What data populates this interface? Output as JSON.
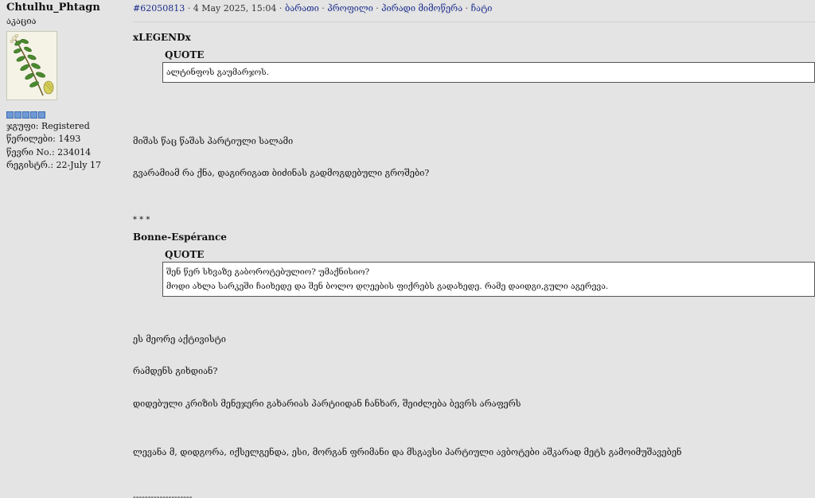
{
  "author": {
    "username": "Chtulhu_Phtagn",
    "title": "აკაცია",
    "avatar_icon": "acacia-branch-illustration",
    "rank_pips": 5,
    "group": "ჯგუფი: Registered",
    "posts": "წერილები: 1493",
    "member_no": "წევრი No.: 234014",
    "registered": "რეგისტრ.: 22-July 17"
  },
  "post_header": {
    "post_id": "#62050813",
    "date": "4 May 2025, 15:04",
    "links": [
      "ბარათი",
      "პროფილი",
      "პირადი მიმოწერა",
      "ჩატი"
    ]
  },
  "quotes": [
    {
      "author": "xLEGENDx",
      "label": "QUOTE",
      "lines": [
        "ალტინფოს გაუმარჯოს."
      ]
    },
    {
      "author": "Bonne-Espérance",
      "label": "QUOTE",
      "lines": [
        "შენ წერ სხვაზე გაბოროტებულიო? უმაქნისიო?",
        "მოდი ახლა სარკეში ჩაიხედე და შენ ბოლო დღეების ფიქრებს გადახედე. რამე დაიდგი,გული აგერევა."
      ]
    }
  ],
  "paragraphs": {
    "p1": "მიშას წაც წაშას პარტიული სალამი",
    "p2": "გვარამიამ რა ქნა, დაგირიგათ ბიძინას გადმოგდებული გროშები?",
    "divider": "* * *",
    "p3": "ეს მეორე აქტივისტი",
    "p4": "რამდენს გიხდიან?",
    "p5": "დიდებული კრიზის მენეჯერი გახარიას პარტიიდან ჩანხარ, შეიძლება ბევრს არაფერს",
    "p6": "ლევანა მ, დიდგორა, იქსელგენდა, ესი, მორგან ფრიმანი და მსგავსი პარტიული ავბოტები აშკარად მეტს გამოიმუშავებენ",
    "signature_rule": "--------------------"
  }
}
